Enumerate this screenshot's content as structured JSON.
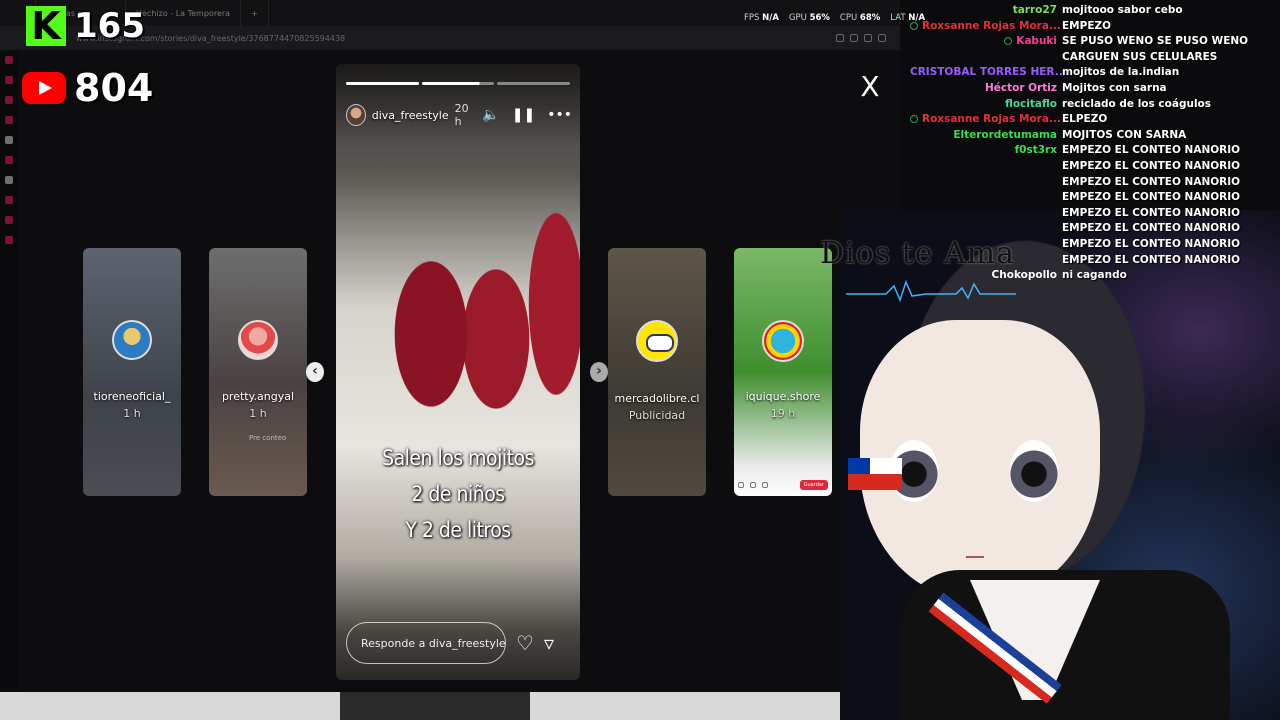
{
  "browser": {
    "tabs": [
      "",
      "istorias •",
      "Hechizo - La Temporera"
    ],
    "url": "www.instagram.com/stories/diva_freestyle/3768774470825594438",
    "perf": {
      "fps_label": "FPS",
      "fps": "N/A",
      "gpu_label": "GPU",
      "gpu": "56%",
      "cpu_label": "CPU",
      "cpu": "68%",
      "lat_label": "LAT",
      "lat": "N/A"
    }
  },
  "overlay": {
    "kick_logo": "K",
    "kick_viewers": "165",
    "youtube_viewers": "804"
  },
  "viewer": {
    "close_label": "X",
    "prev_arrow": "‹",
    "next_arrow": "›",
    "side_cards": [
      {
        "name": "tioreneoficial_",
        "sub": "1 h"
      },
      {
        "name": "pretty.angyal",
        "sub": "1 h",
        "tag": "Pre conteo"
      },
      {
        "name": "mercadolibre.cl",
        "sub": "Publicidad"
      },
      {
        "name": "iquique.shore",
        "sub": "19 h",
        "button": "Guardar"
      }
    ],
    "story": {
      "username": "diva_freestyle",
      "time": "20 h",
      "caption": [
        "Salen los mojitos",
        "2 de niños",
        "Y 2 de litros"
      ],
      "reply_placeholder": "Responde a diva_freestyle...",
      "progress_segments": 3,
      "progress_current": 1
    }
  },
  "stream": {
    "title_overlay": "Dios te Ama"
  },
  "chat": {
    "colors": {
      "green": "#3ddc4a",
      "purple": "#b84bff",
      "red": "#ff3a3a",
      "blue": "#4da3ff"
    },
    "messages": [
      {
        "user": "tarro27",
        "color": "#7be05a",
        "badge": false,
        "text": "mojitooo sabor cebo"
      },
      {
        "user": "Roxsanne Rojas Mora...",
        "color": "#e0313a",
        "badge": true,
        "text": "EMPEZO"
      },
      {
        "user": "Kabuki",
        "color": "#ff3d9a",
        "badge": true,
        "text": "SE PUSO WENO SE PUSO WENO CARGUEN SUS CELULARES"
      },
      {
        "user": "CRISTOBAL TORRES HER...",
        "color": "#9b5cff",
        "badge": false,
        "text": "mojitos de la.indian"
      },
      {
        "user": "Héctor Ortiz",
        "color": "#ff7ad9",
        "badge": false,
        "text": "Mojitos con sarna"
      },
      {
        "user": "flocitaflo",
        "color": "#3ddc9a",
        "badge": false,
        "text": "reciclado de los coágulos"
      },
      {
        "user": "Roxsanne Rojas Mora...",
        "color": "#e0313a",
        "badge": true,
        "text": "ELPEZO"
      },
      {
        "user": "Elterordetumama",
        "color": "#3ddc4a",
        "badge": false,
        "text": "MOJITOS CON SARNA"
      },
      {
        "user": "f0st3rx",
        "color": "#3ddc4a",
        "badge": false,
        "text": "EMPEZO EL CONTEO NANORIO EMPEZO EL CONTEO NANORIO EMPEZO EL CONTEO NANORIO EMPEZO EL CONTEO NANORIO EMPEZO EL CONTEO NANORIO EMPEZO EL CONTEO NANORIO EMPEZO EL CONTEO NANORIO EMPEZO EL CONTEO NANORIO"
      },
      {
        "user": "Chokopollo",
        "color": "#ffffff",
        "badge": false,
        "text": "ni cagando"
      }
    ]
  }
}
